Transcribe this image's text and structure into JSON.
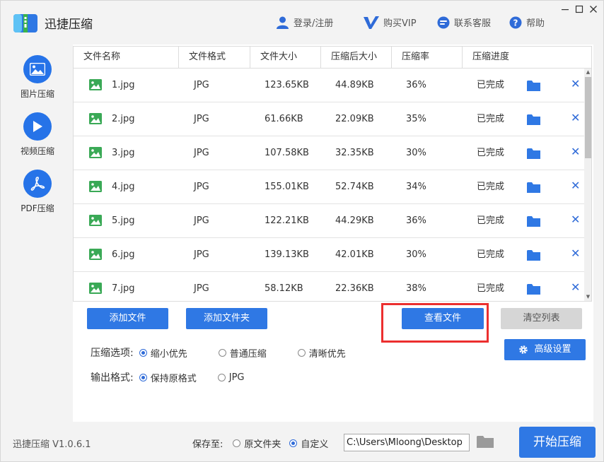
{
  "app": {
    "title": "迅捷压缩",
    "version": "迅捷压缩 V1.0.6.1"
  },
  "topnav": {
    "login": "登录/注册",
    "vip": "购买VIP",
    "support": "联系客服",
    "help": "帮助"
  },
  "sidebar": {
    "items": [
      {
        "label": "图片压缩",
        "icon": "image-icon"
      },
      {
        "label": "视频压缩",
        "icon": "play-icon"
      },
      {
        "label": "PDF压缩",
        "icon": "pdf-icon"
      }
    ]
  },
  "table": {
    "headers": [
      "文件名称",
      "文件格式",
      "文件大小",
      "压缩后大小",
      "压缩率",
      "压缩进度"
    ],
    "rows": [
      {
        "name": "1.jpg",
        "format": "JPG",
        "size": "123.65KB",
        "compressed": "44.89KB",
        "rate": "36%",
        "status": "已完成"
      },
      {
        "name": "2.jpg",
        "format": "JPG",
        "size": "61.66KB",
        "compressed": "22.09KB",
        "rate": "35%",
        "status": "已完成"
      },
      {
        "name": "3.jpg",
        "format": "JPG",
        "size": "107.58KB",
        "compressed": "32.35KB",
        "rate": "30%",
        "status": "已完成"
      },
      {
        "name": "4.jpg",
        "format": "JPG",
        "size": "155.01KB",
        "compressed": "52.74KB",
        "rate": "34%",
        "status": "已完成"
      },
      {
        "name": "5.jpg",
        "format": "JPG",
        "size": "122.21KB",
        "compressed": "44.29KB",
        "rate": "36%",
        "status": "已完成"
      },
      {
        "name": "6.jpg",
        "format": "JPG",
        "size": "139.13KB",
        "compressed": "42.01KB",
        "rate": "30%",
        "status": "已完成"
      },
      {
        "name": "7.jpg",
        "format": "JPG",
        "size": "58.12KB",
        "compressed": "22.36KB",
        "rate": "38%",
        "status": "已完成"
      }
    ]
  },
  "actions": {
    "add_file": "添加文件",
    "add_folder": "添加文件夹",
    "view_files": "查看文件",
    "clear_list": "清空列表",
    "advanced": "高级设置"
  },
  "options": {
    "compress_label": "压缩选项:",
    "compress_choices": [
      "缩小优先",
      "普通压缩",
      "清晰优先"
    ],
    "compress_selected": 0,
    "format_label": "输出格式:",
    "format_choices": [
      "保持原格式",
      "JPG"
    ],
    "format_selected": 0
  },
  "footer": {
    "save_label": "保存至:",
    "save_choices": [
      "原文件夹",
      "自定义"
    ],
    "save_selected": 1,
    "path": "C:\\Users\\Mloong\\Desktop",
    "start": "开始压缩"
  },
  "colors": {
    "accent": "#2f78e4",
    "highlight": "#ec2f2f",
    "icon_green": "#3aa956"
  }
}
